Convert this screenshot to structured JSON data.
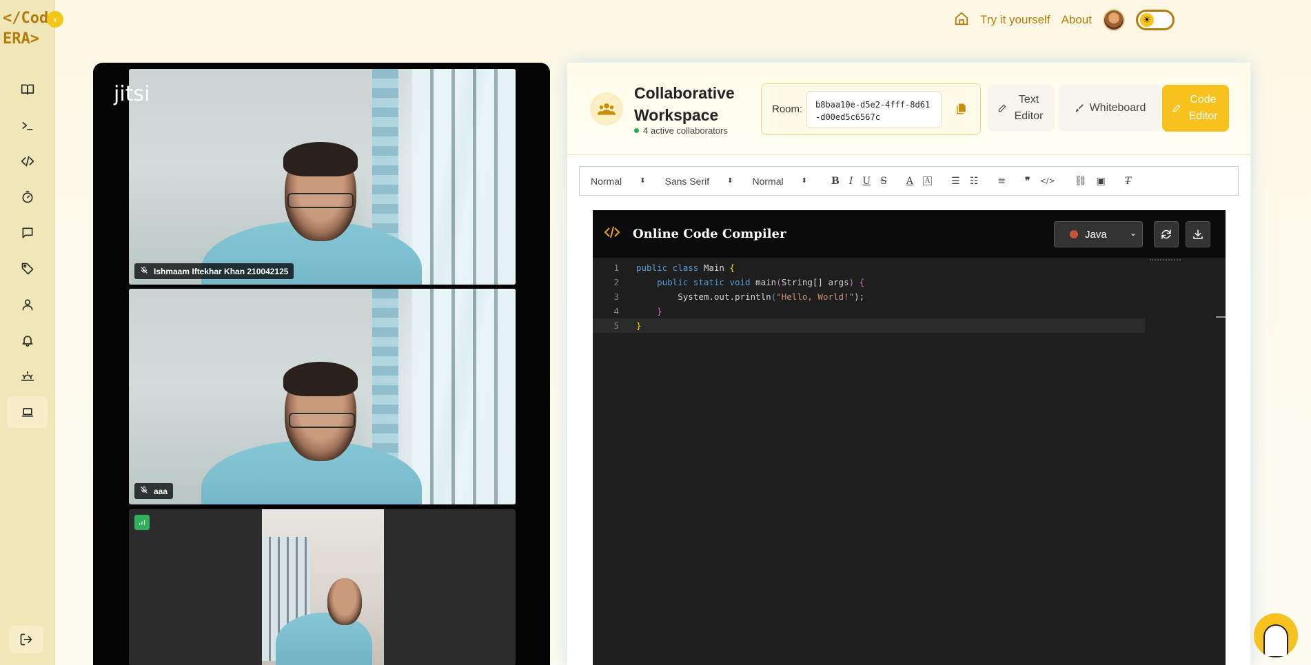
{
  "logo": {
    "line1": "</Cod",
    "line2": "ERA>"
  },
  "sidebar": {
    "toggle_glyph": "›",
    "items": [
      {
        "name": "book-icon"
      },
      {
        "name": "terminal-icon"
      },
      {
        "name": "code-icon"
      },
      {
        "name": "timer-icon"
      },
      {
        "name": "chat-icon"
      },
      {
        "name": "tag-icon"
      },
      {
        "name": "user-icon"
      },
      {
        "name": "bell-icon"
      },
      {
        "name": "sunrise-icon"
      },
      {
        "name": "laptop-icon",
        "active": true
      }
    ]
  },
  "topbar": {
    "try_label": "Try it yourself",
    "about_label": "About",
    "theme_glyph": "☀"
  },
  "video": {
    "brand": "jitsi",
    "participants": [
      {
        "name": "Ishmaam Iftekhar Khan 210042125"
      },
      {
        "name": "aaa"
      }
    ]
  },
  "workspace": {
    "title": "Collaborative Workspace",
    "collaborators": "4 active collaborators",
    "room_label": "Room:",
    "room_id": "b8baa10e-d5e2-4fff-8d61-d00ed5c6567c",
    "modes": {
      "text_editor": "Text Editor",
      "whiteboard": "Whiteboard",
      "code_editor": "Code Editor"
    }
  },
  "toolbar": {
    "header_select": "Normal",
    "font_select": "Sans Serif",
    "size_select": "Normal"
  },
  "compiler": {
    "title": "Online Code Compiler",
    "language": "Java",
    "line_numbers": [
      "1",
      "2",
      "3",
      "4",
      "5"
    ],
    "code": {
      "l1_kw": "public class",
      "l1_name": " Main ",
      "l1_brace": "{",
      "l2_indent": "    ",
      "l2_kw": "public static void",
      "l2_name": " main",
      "l2_paren_open": "(",
      "l2_type": "String[]",
      "l2_arg": " args",
      "l2_paren_close": ")",
      "l2_brace": " {",
      "l3_indent": "        ",
      "l3_call": "System.out.println",
      "l3_paren_open": "(",
      "l3_str": "\"Hello, World!\"",
      "l3_end": ");",
      "l4_indent": "    ",
      "l4_brace": "}",
      "l5_brace": "}"
    }
  }
}
